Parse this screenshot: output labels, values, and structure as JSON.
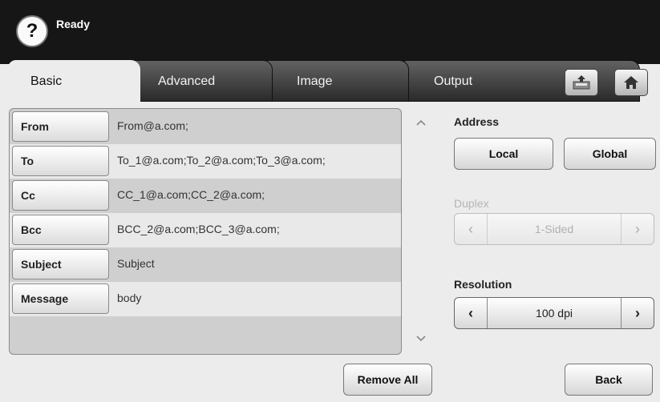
{
  "header": {
    "status": "Ready",
    "help_icon": "?"
  },
  "tabs": [
    {
      "label": "Basic",
      "active": true
    },
    {
      "label": "Advanced",
      "active": false
    },
    {
      "label": "Image",
      "active": false
    },
    {
      "label": "Output",
      "active": false
    }
  ],
  "header_icons": [
    "export-icon",
    "home-icon"
  ],
  "fields": [
    {
      "label": "From",
      "value": "From@a.com;"
    },
    {
      "label": "To",
      "value": "To_1@a.com;To_2@a.com;To_3@a.com;"
    },
    {
      "label": "Cc",
      "value": "CC_1@a.com;CC_2@a.com;"
    },
    {
      "label": "Bcc",
      "value": "BCC_2@a.com;BCC_3@a.com;"
    },
    {
      "label": "Subject",
      "value": "Subject"
    },
    {
      "label": "Message",
      "value": "body"
    }
  ],
  "address": {
    "label": "Address",
    "local": "Local",
    "global": "Global"
  },
  "duplex": {
    "label": "Duplex",
    "value": "1-Sided",
    "enabled": false
  },
  "resolution": {
    "label": "Resolution",
    "value": "100 dpi"
  },
  "actions": {
    "remove_all": "Remove All",
    "back": "Back"
  }
}
